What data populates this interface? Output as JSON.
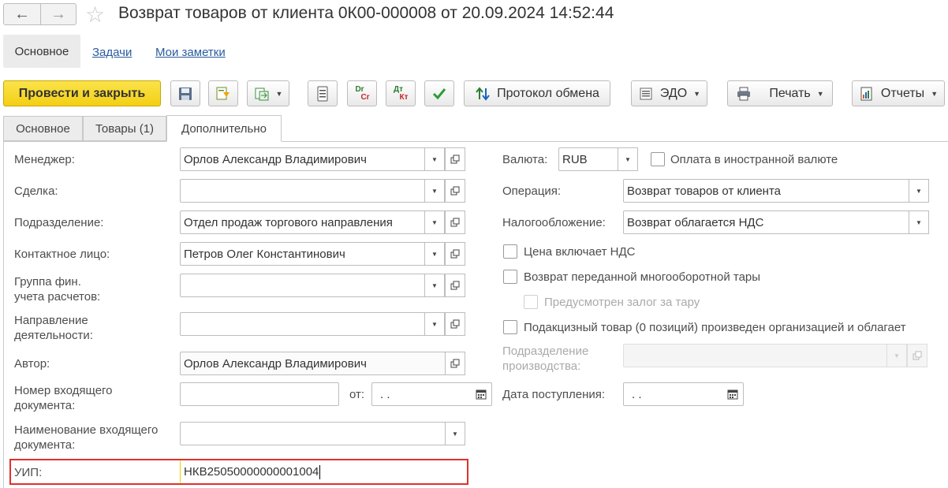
{
  "window": {
    "title": "Возврат товаров от клиента 0К00-000008 от 20.09.2024 14:52:44",
    "back_icon": "arrow-left",
    "forward_icon": "arrow-right",
    "favorite_icon": "star"
  },
  "sections": {
    "active": "Основное",
    "links": [
      "Задачи",
      "Мои заметки"
    ]
  },
  "toolbar": {
    "post_close": "Провести и закрыть",
    "exchange_protocol": "Протокол обмена",
    "edo": "ЭДО",
    "print": "Печать",
    "reports": "Отчеты",
    "dr_label": "Dr",
    "cr_label": "Cr",
    "dt_label": "Дт",
    "kt_label": "Кт"
  },
  "tabs": [
    "Основное",
    "Товары (1)",
    "Дополнительно"
  ],
  "active_tab": "Дополнительно",
  "form": {
    "manager": {
      "label": "Менеджер:",
      "value": "Орлов Александр Владимирович"
    },
    "deal": {
      "label": "Сделка:",
      "value": ""
    },
    "division": {
      "label": "Подразделение:",
      "value": "Отдел продаж торгового направления"
    },
    "contact": {
      "label": "Контактное лицо:",
      "value": "Петров Олег Константинович"
    },
    "fin_group": {
      "label_line1": "Группа фин.",
      "label_line2": "учета расчетов:",
      "value": ""
    },
    "direction": {
      "label_line1": "Направление",
      "label_line2": "деятельности:",
      "value": ""
    },
    "author": {
      "label": "Автор:",
      "value": "Орлов Александр Владимирович"
    },
    "incoming_number": {
      "label_line1": "Номер входящего",
      "label_line2": "документа:",
      "value": "",
      "date_label": "от:",
      "date_value": " .  ."
    },
    "incoming_name": {
      "label_line1": "Наименование входящего",
      "label_line2": "документа:",
      "value": ""
    },
    "uip": {
      "label": "УИП:",
      "value": "НКВ25050000000001004"
    },
    "currency": {
      "label": "Валюта:",
      "value": "RUB"
    },
    "foreign_currency_payment": {
      "label": "Оплата в иностранной валюте",
      "checked": false
    },
    "operation": {
      "label": "Операция:",
      "value": "Возврат товаров от клиента"
    },
    "taxation": {
      "label": "Налогообложение:",
      "value": "Возврат облагается НДС"
    },
    "price_includes_vat": {
      "label": "Цена включает НДС",
      "checked": false
    },
    "returnable_tare": {
      "label": "Возврат переданной многооборотной тары",
      "checked": false
    },
    "tare_deposit": {
      "label": "Предусмотрен залог за тару",
      "checked": false
    },
    "excise": {
      "label": "Подакцизный товар (0 позиций) произведен организацией и облагает",
      "checked": false
    },
    "production_division": {
      "label_line1": "Подразделение",
      "label_line2": "производства:",
      "value": ""
    },
    "receipt_date": {
      "label": "Дата поступления:",
      "value": " .  ."
    }
  },
  "colors": {
    "primary_button": "#f5d321",
    "link": "#2a5c9e",
    "highlight_border": "#e0302c"
  }
}
